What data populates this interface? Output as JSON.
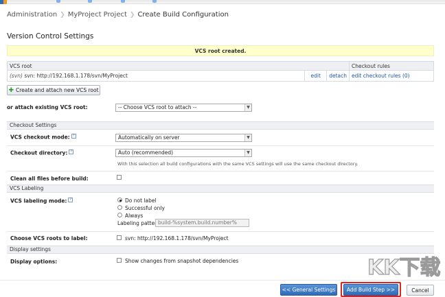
{
  "breadcrumb": {
    "items": [
      "Administration",
      "MyProject Project",
      "Create Build Configuration"
    ]
  },
  "section_title": "Version Control Settings",
  "banner": "VCS root created.",
  "vcs_table": {
    "headers": {
      "vcs_root": "VCS root",
      "checkout_rules": "Checkout rules"
    },
    "row": {
      "type": "(svn)",
      "url": "svn: http://192.168.1.178/svn/MyProject",
      "edit": "edit",
      "detach": "detach",
      "edit_rules": "edit checkout rules (0)"
    }
  },
  "create_button": "Create and attach new VCS root",
  "attach_existing": {
    "label": "or attach existing VCS root:",
    "value": "-- Choose VCS root to attach --"
  },
  "checkout_settings": {
    "header": "Checkout Settings",
    "mode_label": "VCS checkout mode:",
    "mode_value": "Automatically on server",
    "dir_label": "Checkout directory:",
    "dir_value": "Auto (recommended)",
    "dir_note": "With this selection all build configurations with the same VCS settings will use the same checkout directory.",
    "clean_label": "Clean all files before build:"
  },
  "vcs_labeling": {
    "header": "VCS Labeling",
    "mode_label": "VCS labeling mode:",
    "options": [
      "Do not label",
      "Successful only",
      "Always"
    ],
    "selected": "Do not label",
    "pattern_label": "Labeling pattern:",
    "pattern_value": "build-%system.build.number%",
    "roots_label": "Choose VCS roots to label:",
    "root_option": "svn: http://192.168.1.178/svn/MyProject"
  },
  "display_settings": {
    "header": "Display settings",
    "options_label": "Display options:",
    "option_text": "Show changes from snapshot dependencies"
  },
  "buttons": {
    "general": "<< General Settings",
    "add_step": "Add Build Step >>",
    "cancel": "Cancel"
  },
  "help_glyph": "?",
  "watermark": "KK下载",
  "colors": {
    "primary_button": "#2f6bb8",
    "highlight_outline": "#dd2222",
    "banner_bg": "#ffffcc",
    "link": "#1a56a8"
  }
}
